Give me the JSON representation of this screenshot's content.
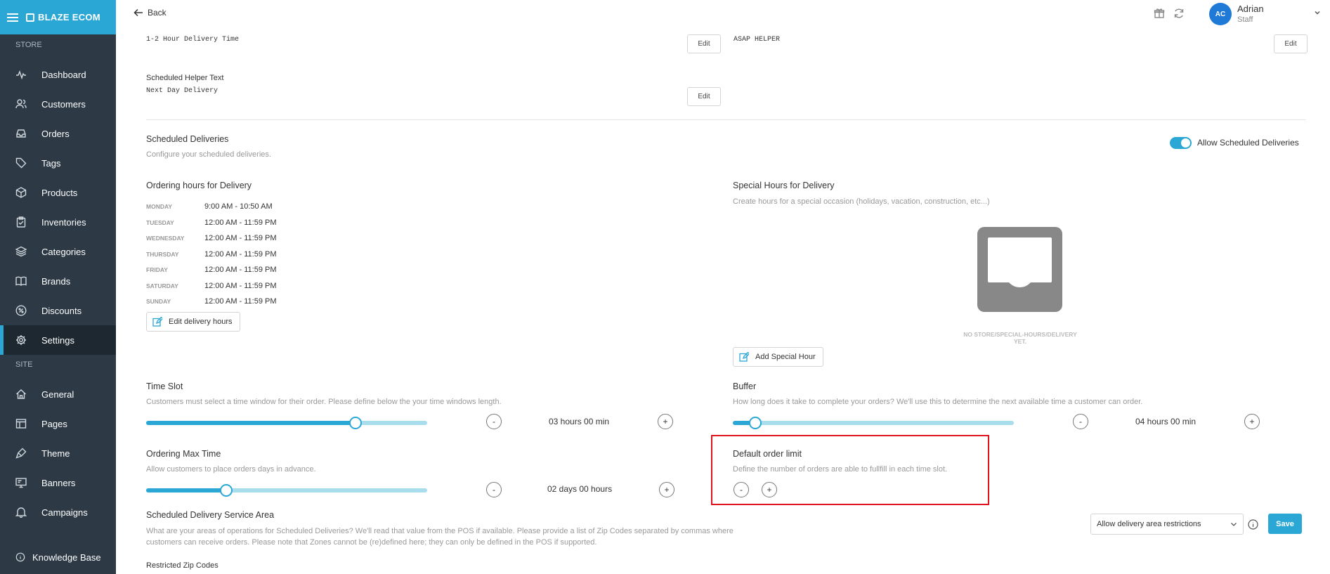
{
  "app": {
    "brand": "BLAZE ECOM"
  },
  "sidebar": {
    "store_label": "STORE",
    "site_label": "SITE",
    "store_items": [
      {
        "label": "Dashboard",
        "icon": "activity-icon"
      },
      {
        "label": "Customers",
        "icon": "users-icon"
      },
      {
        "label": "Orders",
        "icon": "inbox-icon"
      },
      {
        "label": "Tags",
        "icon": "tag-icon"
      },
      {
        "label": "Products",
        "icon": "box-icon"
      },
      {
        "label": "Inventories",
        "icon": "clipboard-icon"
      },
      {
        "label": "Categories",
        "icon": "layers-icon"
      },
      {
        "label": "Brands",
        "icon": "book-icon"
      },
      {
        "label": "Discounts",
        "icon": "percent-icon"
      },
      {
        "label": "Settings",
        "icon": "gear-icon",
        "active": true
      }
    ],
    "site_items": [
      {
        "label": "General",
        "icon": "home-icon"
      },
      {
        "label": "Pages",
        "icon": "layout-icon"
      },
      {
        "label": "Theme",
        "icon": "brush-icon"
      },
      {
        "label": "Banners",
        "icon": "monitor-icon"
      },
      {
        "label": "Campaigns",
        "icon": "bell-icon"
      }
    ],
    "knowledge_base": "Knowledge Base"
  },
  "topbar": {
    "back_label": "Back",
    "user": {
      "initials": "AC",
      "name": "Adrian",
      "role": "Staff"
    }
  },
  "helper_text": {
    "asap_value": "1-2 Hour Delivery Time",
    "asap_right_value": "ASAP HELPER",
    "scheduled_label": "Scheduled Helper Text",
    "scheduled_value": "Next Day Delivery",
    "edit_label": "Edit"
  },
  "scheduled": {
    "title": "Scheduled Deliveries",
    "desc": "Configure your scheduled deliveries.",
    "toggle_label": "Allow Scheduled Deliveries",
    "toggle_on": true
  },
  "ordering_hours": {
    "title": "Ordering hours for Delivery",
    "days": [
      {
        "day": "MONDAY",
        "hours": "9:00 AM - 10:50 AM"
      },
      {
        "day": "TUESDAY",
        "hours": "12:00 AM - 11:59 PM"
      },
      {
        "day": "WEDNESDAY",
        "hours": "12:00 AM - 11:59 PM"
      },
      {
        "day": "THURSDAY",
        "hours": "12:00 AM - 11:59 PM"
      },
      {
        "day": "FRIDAY",
        "hours": "12:00 AM - 11:59 PM"
      },
      {
        "day": "SATURDAY",
        "hours": "12:00 AM - 11:59 PM"
      },
      {
        "day": "SUNDAY",
        "hours": "12:00 AM - 11:59 PM"
      }
    ],
    "edit_button": "Edit delivery hours"
  },
  "special_hours": {
    "title": "Special Hours for Delivery",
    "desc": "Create hours for a special occasion (holidays, vacation, construction, etc...)",
    "empty_text": "NO STORE/SPECIAL-HOURS/DELIVERY YET.",
    "add_button": "Add Special Hour"
  },
  "time_slot": {
    "title": "Time Slot",
    "desc": "Customers must select a time window for their order. Please define below the your time windows length.",
    "value": "03 hours 00 min",
    "slider_fraction": 0.745
  },
  "buffer": {
    "title": "Buffer",
    "desc": "How long does it take to complete your orders? We'll use this to determine the next available time a customer can order.",
    "value": "04 hours 00 min",
    "slider_fraction": 0.08
  },
  "ordering_max": {
    "title": "Ordering Max Time",
    "desc": "Allow customers to place orders days in advance.",
    "value": "02 days 00 hours",
    "slider_fraction": 0.285
  },
  "order_limit": {
    "title": "Default order limit",
    "desc": "Define the number of orders are able to fullfill in each time slot."
  },
  "stepper": {
    "minus": "-",
    "plus": "+"
  },
  "service_area": {
    "title": "Scheduled Delivery Service Area",
    "desc_line1": "What are your areas of operations for Scheduled Deliveries? We'll read that value from the POS if available. Please provide a list of Zip Codes separated by commas where",
    "desc_line2": "customers can receive orders. Please note that Zones cannot be (re)defined here; they can only be defined in the POS if supported.",
    "select_value": "Allow delivery area restrictions",
    "save_label": "Save",
    "restricted_label": "Restricted Zip Codes"
  },
  "colors": {
    "accent": "#2ba7d6",
    "sidebar": "#2d3a46",
    "highlight": "#e0141e"
  }
}
